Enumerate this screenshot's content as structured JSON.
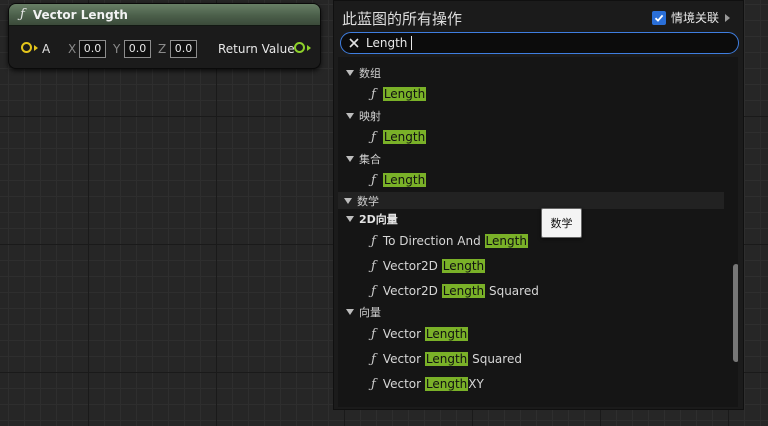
{
  "node": {
    "fn_glyph": "ƒ",
    "title": "Vector Length",
    "input_pin_label": "A",
    "x_label": "X",
    "x_value": "0.0",
    "y_label": "Y",
    "y_value": "0.0",
    "z_label": "Z",
    "z_value": "0.0",
    "output_label": "Return Value",
    "header_color": "#566e55",
    "input_pin_color": "#e4c51b",
    "output_pin_color": "#8ed12b"
  },
  "menu": {
    "title": "此蓝图的所有操作",
    "context_sensitive_label": "情境关联",
    "context_sensitive_checked": true,
    "search": {
      "value": "Length",
      "clear_icon": "close-icon"
    },
    "highlight_color": "#7ab128",
    "rows": [
      {
        "type": "category",
        "label": "数组",
        "bold": false
      },
      {
        "type": "item",
        "pre": "",
        "match": "Length",
        "post": ""
      },
      {
        "type": "category",
        "label": "映射",
        "bold": false
      },
      {
        "type": "item",
        "pre": "",
        "match": "Length",
        "post": ""
      },
      {
        "type": "category",
        "label": "集合",
        "bold": false
      },
      {
        "type": "item",
        "pre": "",
        "match": "Length",
        "post": ""
      },
      {
        "type": "category",
        "label": "数学",
        "bold": false
      },
      {
        "type": "category",
        "label": "2D向量",
        "bold": true
      },
      {
        "type": "item",
        "pre": "To Direction And ",
        "match": "Length",
        "post": ""
      },
      {
        "type": "item",
        "pre": "Vector2D ",
        "match": "Length",
        "post": ""
      },
      {
        "type": "item",
        "pre": "Vector2D ",
        "match": "Length",
        "post": " Squared"
      },
      {
        "type": "category",
        "label": "向量",
        "bold": false
      },
      {
        "type": "item",
        "pre": "Vector ",
        "match": "Length",
        "post": ""
      },
      {
        "type": "item",
        "pre": "Vector ",
        "match": "Length",
        "post": " Squared"
      },
      {
        "type": "item",
        "pre": "Vector ",
        "match": "Length",
        "post": "XY"
      }
    ]
  },
  "tooltip": {
    "text": "数学"
  }
}
